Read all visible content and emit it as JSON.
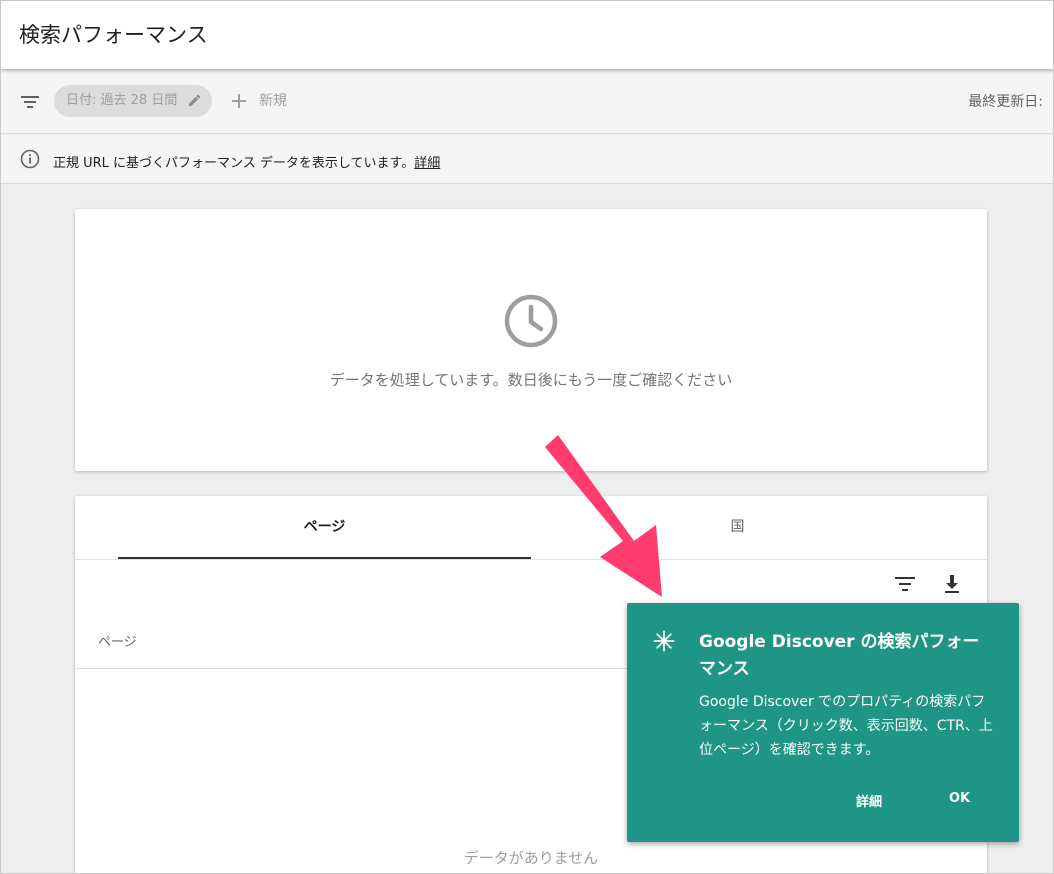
{
  "header": {
    "title": "検索パフォーマンス"
  },
  "toolbar": {
    "date_filter": "日付: 過去 28 日間",
    "add_new": "新規",
    "last_updated": "最終更新日:"
  },
  "info_bar": {
    "message": "正規 URL に基づくパフォーマンス データを表示しています。",
    "link": "詳細"
  },
  "processing_card": {
    "message": "データを処理しています。数日後にもう一度ご確認ください"
  },
  "table_card": {
    "tabs": [
      {
        "label": "ページ"
      },
      {
        "label": "国"
      }
    ],
    "column_header": "ページ",
    "empty_message": "データがありません"
  },
  "popup": {
    "title": "Google Discover の検索パフォーマンス",
    "body": "Google Discover でのプロパティの検索パフォーマンス（クリック数、表示回数、CTR、上位ページ）を確認できます。",
    "details_button": "詳細",
    "ok_button": "OK",
    "bg_color": "#1e9585"
  },
  "annotation": {
    "arrow_color": "#ff3b6f"
  },
  "icons": [
    "filter-icon",
    "pencil-icon",
    "plus-icon",
    "info-icon",
    "clock-icon",
    "download-icon",
    "sparkle-icon"
  ]
}
